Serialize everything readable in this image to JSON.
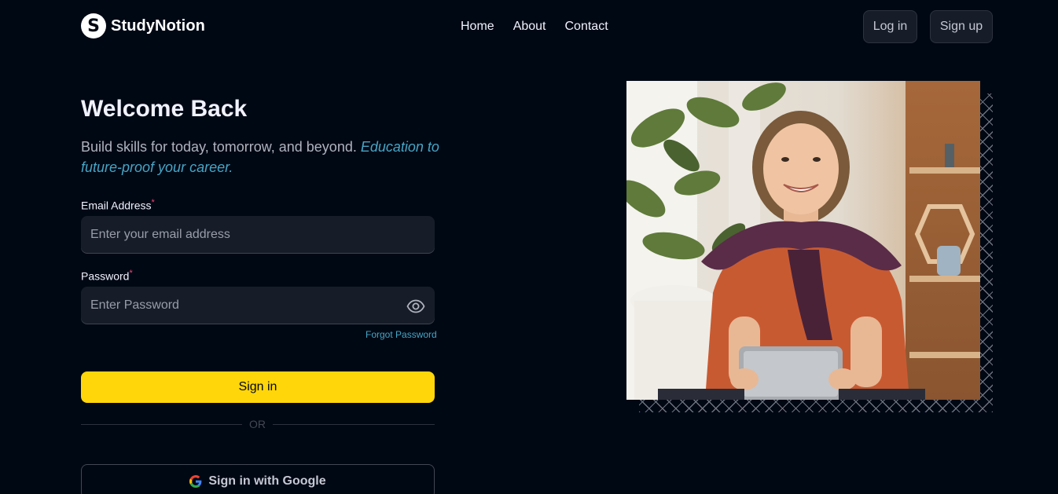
{
  "brand": {
    "name": "StudyNotion",
    "mark": "S"
  },
  "nav": {
    "links": [
      "Home",
      "About",
      "Contact"
    ],
    "login": "Log in",
    "signup": "Sign up"
  },
  "login": {
    "title": "Welcome Back",
    "subtitle": "Build skills for today, tomorrow, and beyond.",
    "subtitle_highlight": "Education to future-proof your career.",
    "email_label": "Email Address",
    "email_placeholder": "Enter your email address",
    "password_label": "Password",
    "password_placeholder": "Enter Password",
    "required_mark": "*",
    "forgot": "Forgot Password",
    "submit": "Sign in",
    "or": "OR",
    "google": "Sign in with Google"
  },
  "colors": {
    "accent": "#ffd60a",
    "link": "#47a5c5",
    "required": "#ef476f",
    "bg": "#000814"
  }
}
